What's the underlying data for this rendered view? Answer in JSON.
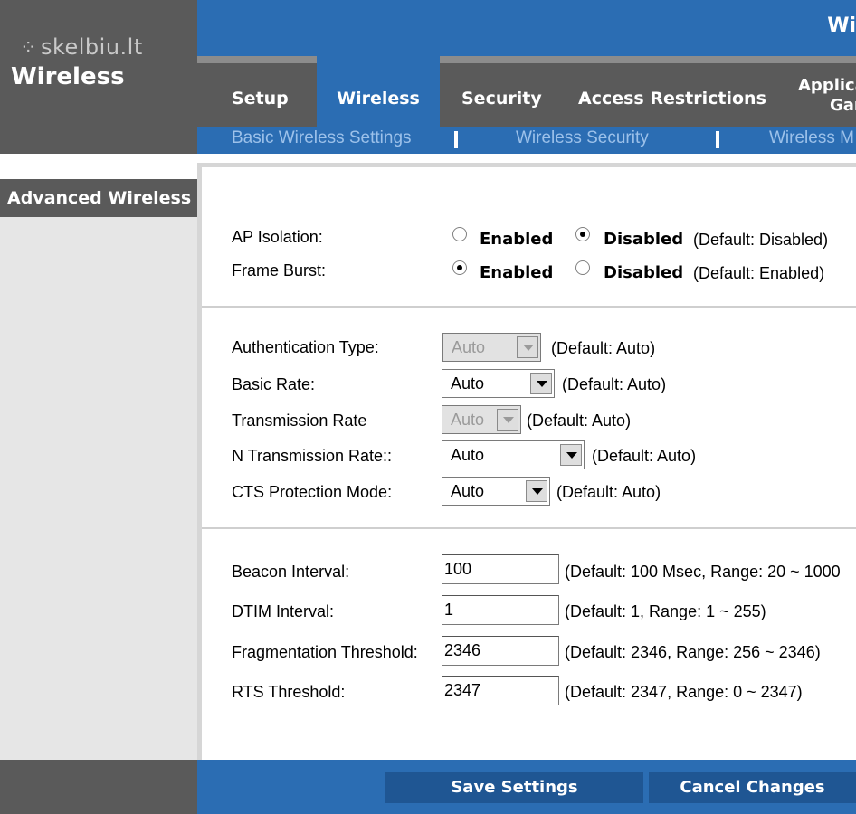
{
  "watermark": "skelbiu.lt",
  "section_title": "Wireless",
  "brand_partial": "Wi",
  "tabs": [
    {
      "label": "Setup"
    },
    {
      "label": "Wireless"
    },
    {
      "label": "Security"
    },
    {
      "label": "Access Restrictions"
    },
    {
      "label_line1": "Applica",
      "label_line2": "Gam"
    }
  ],
  "subtabs": [
    "Basic Wireless Settings",
    "Wireless Security",
    "Wireless M"
  ],
  "sidebar": {
    "active_item": "Advanced Wireless"
  },
  "ap_isolation": {
    "label": "AP Isolation:",
    "enabled": "Enabled",
    "disabled": "Disabled",
    "selected": "Disabled",
    "note": "(Default: Disabled)"
  },
  "frame_burst": {
    "label": "Frame Burst:",
    "enabled": "Enabled",
    "disabled": "Disabled",
    "selected": "Enabled",
    "note": "(Default: Enabled)"
  },
  "auth_type": {
    "label": "Authentication Type:",
    "value": "Auto",
    "note": "(Default: Auto)",
    "disabled": true
  },
  "basic_rate": {
    "label": "Basic Rate:",
    "value": "Auto",
    "note": "(Default: Auto)"
  },
  "transmission_rate": {
    "label": "Transmission Rate",
    "value": "Auto",
    "note": "(Default: Auto)",
    "disabled": true
  },
  "n_transmission_rate": {
    "label": "N Transmission Rate::",
    "value": "Auto",
    "note": "(Default: Auto)"
  },
  "cts_mode": {
    "label": "CTS Protection Mode:",
    "value": "Auto",
    "note": "(Default: Auto)"
  },
  "beacon": {
    "label": "Beacon Interval:",
    "value": "100",
    "note": "(Default: 100 Msec, Range: 20 ~ 1000"
  },
  "dtim": {
    "label": "DTIM Interval:",
    "value": "1",
    "note": "(Default: 1, Range: 1 ~ 255)"
  },
  "fragmentation": {
    "label": "Fragmentation Threshold:",
    "value": "2346",
    "note": "(Default: 2346, Range: 256 ~ 2346)"
  },
  "rts": {
    "label": "RTS Threshold:",
    "value": "2347",
    "note": "(Default: 2347, Range: 0 ~ 2347)"
  },
  "footer": {
    "save_label": "Save Settings",
    "cancel_label": "Cancel Changes"
  },
  "colors": {
    "header_blue": "#2b6db3",
    "dark_gray": "#5a5a5a",
    "button_blue": "#1f5693",
    "subtab_text": "#9cc1ea"
  }
}
